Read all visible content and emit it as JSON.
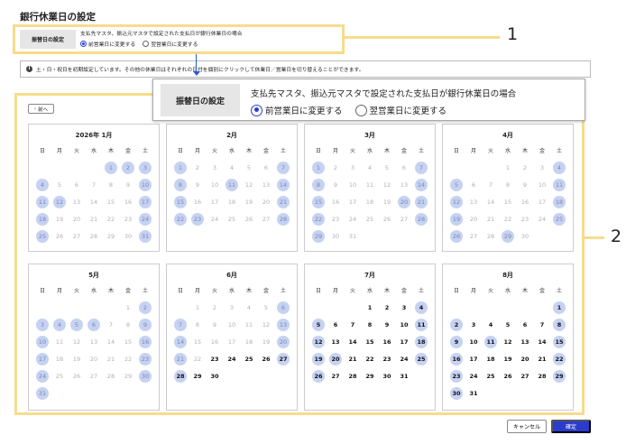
{
  "page_title": "銀行休業日の設定",
  "setting": {
    "label": "振替日の設定",
    "description": "支払先マスタ、振込元マスタで設定された支払日が銀行休業日の場合",
    "options": [
      "前営業日に変更する",
      "翌営業日に変更する"
    ],
    "selected_index": 0
  },
  "callout_1": "1",
  "callout_2": "2",
  "info_icon": "info-icon",
  "info_text": "土・日・祝日を初期設定しています。その他の休業日はそれぞれの日付を個別にクリックして休業日／営業日を切り替えることができます。",
  "prev_button": "前へ",
  "weekdays": [
    "日",
    "月",
    "火",
    "水",
    "木",
    "金",
    "土"
  ],
  "months": [
    {
      "title": "2026年 1月",
      "start": 4,
      "days": 31,
      "holidays": [
        1,
        2,
        3,
        4,
        10,
        11,
        12,
        17,
        18,
        24,
        25,
        31
      ],
      "active_from": null
    },
    {
      "title": "2月",
      "start": 0,
      "days": 28,
      "holidays": [
        1,
        7,
        8,
        11,
        14,
        15,
        21,
        22,
        23,
        28
      ],
      "active_from": null
    },
    {
      "title": "3月",
      "start": 0,
      "days": 31,
      "holidays": [
        1,
        7,
        8,
        14,
        15,
        20,
        21,
        22,
        28,
        29
      ],
      "active_from": null
    },
    {
      "title": "4月",
      "start": 3,
      "days": 30,
      "holidays": [
        4,
        5,
        11,
        12,
        18,
        19,
        25,
        26,
        29
      ],
      "active_from": null
    },
    {
      "title": "5月",
      "start": 5,
      "days": 31,
      "holidays": [
        2,
        3,
        4,
        5,
        6,
        9,
        10,
        16,
        17,
        23,
        24,
        30,
        31
      ],
      "active_from": null
    },
    {
      "title": "6月",
      "start": 1,
      "days": 30,
      "holidays": [
        6,
        7,
        13,
        14,
        20,
        21,
        27,
        28
      ],
      "active_from": 23
    },
    {
      "title": "7月",
      "start": 3,
      "days": 31,
      "holidays": [
        4,
        5,
        11,
        12,
        18,
        19,
        20,
        25,
        26
      ],
      "active_from": 1
    },
    {
      "title": "8月",
      "start": 6,
      "days": 31,
      "holidays": [
        1,
        2,
        8,
        9,
        11,
        15,
        16,
        22,
        23,
        29,
        30
      ],
      "active_from": 1
    }
  ],
  "cancel_button": "キャンセル",
  "confirm_button": "確定",
  "accent_color": "#2b3bcc",
  "highlight_color": "#f6dc8c",
  "holiday_color": "#c6d2f2"
}
